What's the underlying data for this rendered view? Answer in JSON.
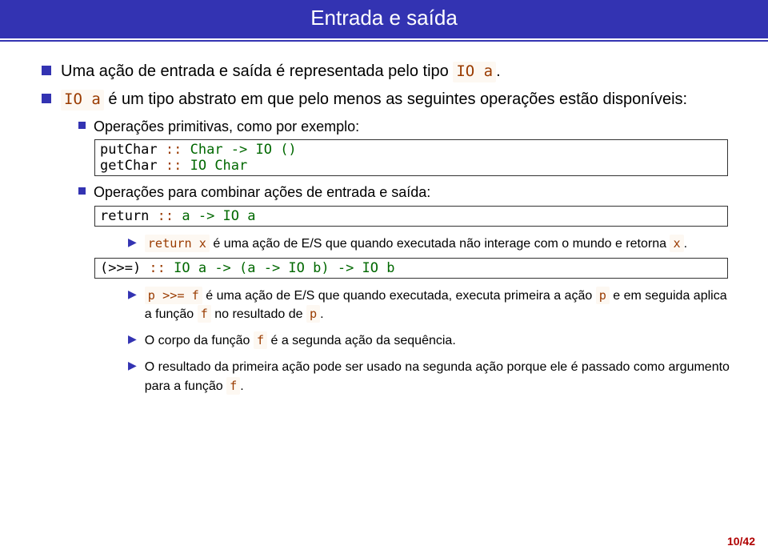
{
  "title": "Entrada e saída",
  "l1_item1": {
    "prefix": "Uma ação de entrada e saída é representada pelo tipo ",
    "code": "IO a",
    "suffix": "."
  },
  "l1_item2": {
    "code": "IO a",
    "text": " é um tipo abstrato em que pelo menos as seguintes operações estão disponíveis:"
  },
  "l2_prims": "Operações primitivas, como por exemplo:",
  "codebox1": {
    "line1_fn": "putChar",
    "line1_sig": " :: ",
    "line1_ty": "Char -> IO ()",
    "line2_fn": "getChar",
    "line2_sig": " :: ",
    "line2_ty": "IO Char"
  },
  "l2_comb": "Operações para combinar ações de entrada e saída:",
  "codebox2": {
    "fn": "return",
    "sig": " :: ",
    "ty": "a -> IO a"
  },
  "l3_return": {
    "code1": "return x",
    "mid": " é uma ação de E/S que quando executada não interage com o mundo e retorna ",
    "code2": "x",
    "suffix": "."
  },
  "codebox3": {
    "fn": "(>>=)",
    "sig": " :: ",
    "ty": "IO a -> (a -> IO b) -> IO b"
  },
  "l3_bind": {
    "code1": "p >>= f",
    "mid": " é uma ação de E/S que quando executada, executa primeira a ação ",
    "code2": "p",
    "mid2": " e em seguida aplica a função ",
    "code3": "f",
    "mid3": " no resultado de ",
    "code4": "p",
    "suffix": "."
  },
  "l3_corpo": {
    "pre": "O corpo da função ",
    "code": "f",
    "post": " é a segunda ação da sequência."
  },
  "l3_resultado": {
    "pre": "O resultado da primeira ação pode ser usado na segunda ação porque ele é passado como argumento para a função ",
    "code": "f",
    "post": "."
  },
  "pagenum": "10/42"
}
